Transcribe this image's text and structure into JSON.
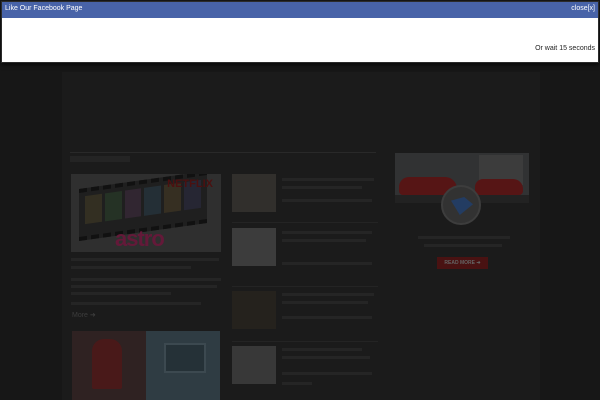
{
  "modal": {
    "title": "Like Our Facebook Page",
    "close_label": "close[x]",
    "wait_text": "Or wait 15 seconds",
    "header_color": "#4863a8"
  },
  "featured": {
    "brand_top": "NETFLIX",
    "brand_bottom": "astro",
    "more_label": "More"
  },
  "widget": {
    "read_more_label": "READ MORE"
  },
  "icons": [
    "close-icon",
    "arrow-circle-icon"
  ]
}
